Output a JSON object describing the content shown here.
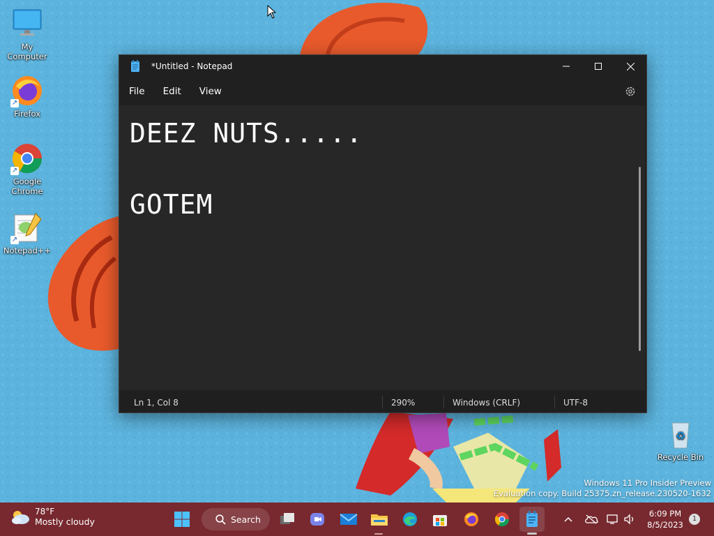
{
  "desktop": {
    "icons": [
      {
        "label": "My Computer"
      },
      {
        "label": "Firefox"
      },
      {
        "label": "Google Chrome"
      },
      {
        "label": "Notepad++"
      },
      {
        "label": "Recycle Bin"
      }
    ],
    "watermark": {
      "line1": "Windows 11 Pro Insider Preview",
      "line2": "Evaluation copy. Build 25375.zn_release.230520-1632"
    }
  },
  "notepad": {
    "title": "*Untitled - Notepad",
    "menu": [
      "File",
      "Edit",
      "View"
    ],
    "content": {
      "line1": "DEEZ NUTS.....",
      "line2": "GOTEM"
    },
    "status": {
      "position": "Ln 1, Col 8",
      "zoom": "290%",
      "line_ending": "Windows (CRLF)",
      "encoding": "UTF-8"
    }
  },
  "taskbar": {
    "weather": {
      "temp": "78°F",
      "condition": "Mostly cloudy"
    },
    "search_label": "Search",
    "clock": {
      "time": "6:09 PM",
      "date": "8/5/2023"
    },
    "notification_count": "1",
    "pinned": [
      "start-icon",
      "search-icon",
      "task-view-icon",
      "teams-icon",
      "mail-icon",
      "file-explorer-icon",
      "edge-icon",
      "store-icon",
      "firefox-icon",
      "chrome-icon",
      "notepad-icon"
    ],
    "tray": [
      "chevron-up-icon",
      "onedrive-icon",
      "network-icon",
      "volume-icon"
    ]
  },
  "colors": {
    "accent_taskbar": "#782328",
    "notepad_bg": "#272727",
    "desktop_bg": "#5fb4dc"
  }
}
